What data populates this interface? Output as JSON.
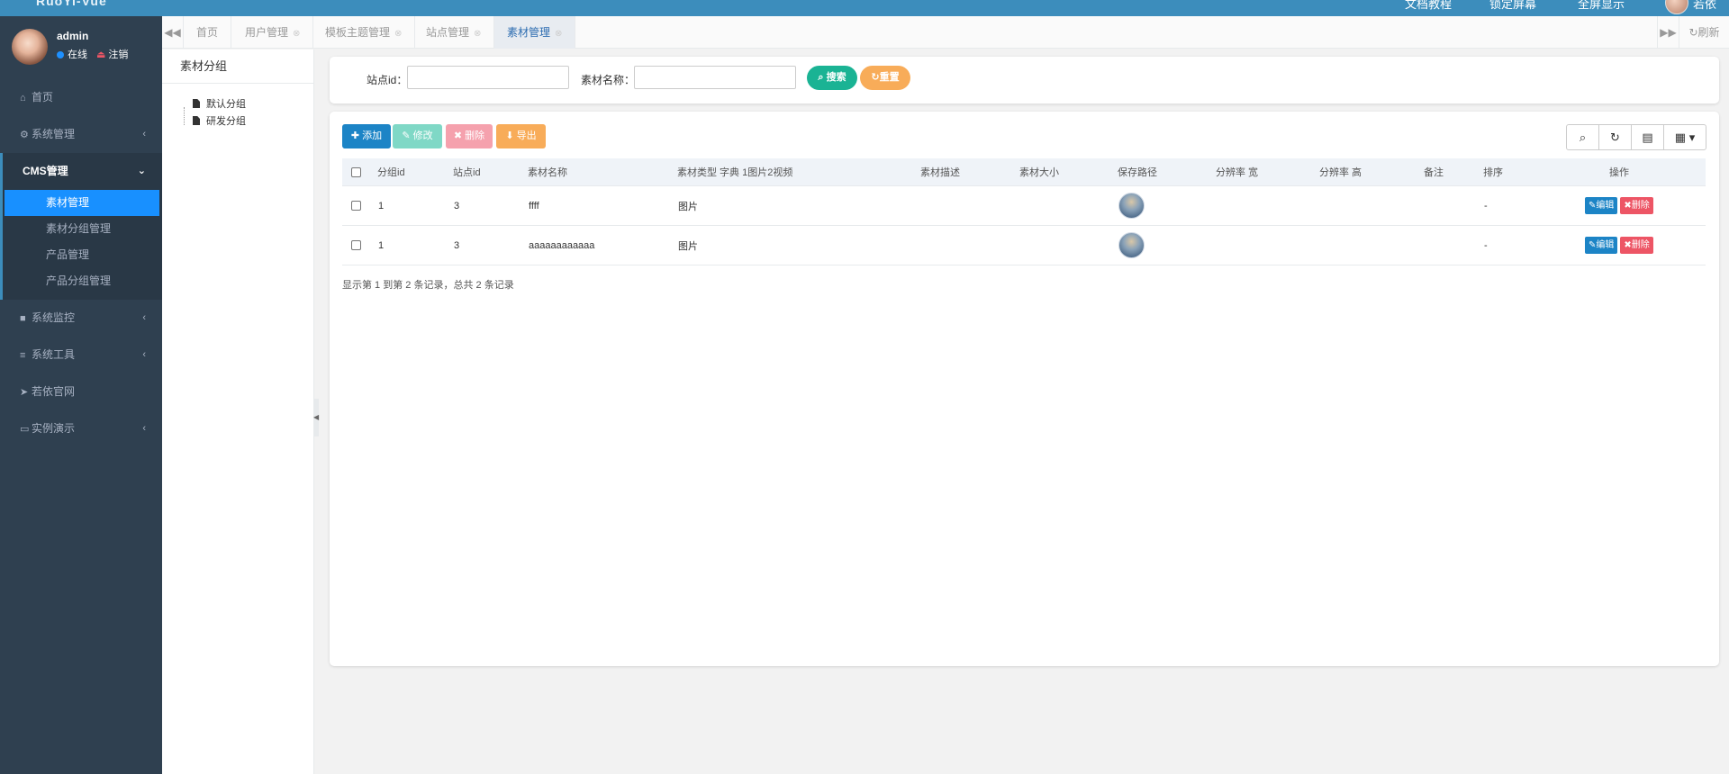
{
  "header": {
    "logo_text": "RuoYi-Vue",
    "items": [
      "文档教程",
      "锁定屏幕",
      "全屏显示"
    ],
    "user_short": "若依"
  },
  "sidebar": {
    "user": {
      "name": "admin",
      "status": "在线",
      "logout": "注销"
    },
    "items": [
      {
        "label": "首页",
        "icon": "home-icon"
      },
      {
        "label": "系统管理",
        "icon": "gear-icon"
      },
      {
        "label": "CMS管理",
        "icon": "none",
        "sub": [
          "素材管理",
          "素材分组管理",
          "产品管理",
          "产品分组管理"
        ],
        "active_sub": "素材管理"
      },
      {
        "label": "系统监控",
        "icon": "video-icon"
      },
      {
        "label": "系统工具",
        "icon": "bars-icon"
      },
      {
        "label": "若依官网",
        "icon": "paper-plane-icon"
      },
      {
        "label": "实例演示",
        "icon": "desktop-icon"
      }
    ]
  },
  "tabs": [
    {
      "label": "首页"
    },
    {
      "label": "用户管理"
    },
    {
      "label": "模板主题管理"
    },
    {
      "label": "站点管理"
    },
    {
      "label": "素材管理",
      "active": true
    }
  ],
  "tabs_refresh": "刷新",
  "tree": {
    "title": "素材分组",
    "nodes": [
      "默认分组",
      "研发分组"
    ]
  },
  "search": {
    "site_id_label": "站点id：",
    "site_id_value": "",
    "name_label": "素材名称：",
    "name_value": "",
    "search_btn": "搜索",
    "reset_btn": "重置"
  },
  "toolbar": {
    "add": "添加",
    "edit": "修改",
    "delete": "删除",
    "export": "导出"
  },
  "table": {
    "columns": [
      "分组id",
      "站点id",
      "素材名称",
      "素材类型 字典 1图片2视频",
      "素材描述",
      "素材大小",
      "保存路径",
      "分辨率 宽",
      "分辨率 高",
      "备注",
      "排序",
      "操作"
    ],
    "rows": [
      {
        "group_id": "1",
        "site_id": "3",
        "name": "ffff",
        "type": "图片",
        "sort": "-"
      },
      {
        "group_id": "1",
        "site_id": "3",
        "name": "aaaaaaaaaaaa",
        "type": "图片",
        "sort": "-"
      }
    ],
    "row_edit": "编辑",
    "row_delete": "删除",
    "pager": "显示第 1 到第 2 条记录，总共 2 条记录"
  },
  "colors": {
    "sidebar_bg": "#2f4050",
    "active_blue": "#1890ff",
    "top_blue": "#3c8dbc",
    "success": "#1ab394",
    "warning": "#f8ac59",
    "danger": "#ed5565",
    "primary": "#1c84c6"
  }
}
